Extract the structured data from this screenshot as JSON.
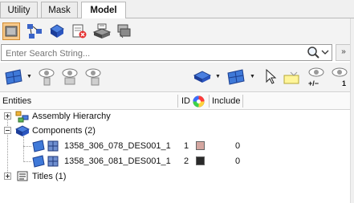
{
  "tabs": [
    {
      "label": "Utility",
      "active": false
    },
    {
      "label": "Mask",
      "active": false
    },
    {
      "label": "Model",
      "active": true
    }
  ],
  "search": {
    "placeholder": "Enter Search String..."
  },
  "columns": {
    "entities": "Entities",
    "id": "ID",
    "include": "Include"
  },
  "tree": {
    "assembly": {
      "label": "Assembly Hierarchy"
    },
    "components": {
      "label": "Components (2)",
      "children": [
        {
          "name": "1358_306_078_DES001_1",
          "id": "1",
          "color": "#d4a6a0",
          "include": "0"
        },
        {
          "name": "1358_306_081_DES001_1",
          "id": "2",
          "color": "#2a2a2a",
          "include": "0"
        }
      ]
    },
    "titles": {
      "label": "Titles (1)"
    }
  },
  "icons": {
    "toolbar1": [
      "solid-box-icon",
      "node-network-icon",
      "component-blue-icon",
      "delete-red-icon",
      "mask-icon",
      "stack-icon"
    ],
    "toolbar2": [
      "blue-folder-icon",
      "visibility-eye-icon",
      "visibility-eye-icon",
      "visibility-eye-icon",
      "blue-diamond-icon",
      "blue-folder-icon",
      "cursor-arrow-icon",
      "highlight-icon",
      "eye-plus-minus-icon",
      "eye-one-icon"
    ]
  },
  "labels": {
    "plus_minus": "+/−",
    "one": "1",
    "double_arrow": "»"
  }
}
